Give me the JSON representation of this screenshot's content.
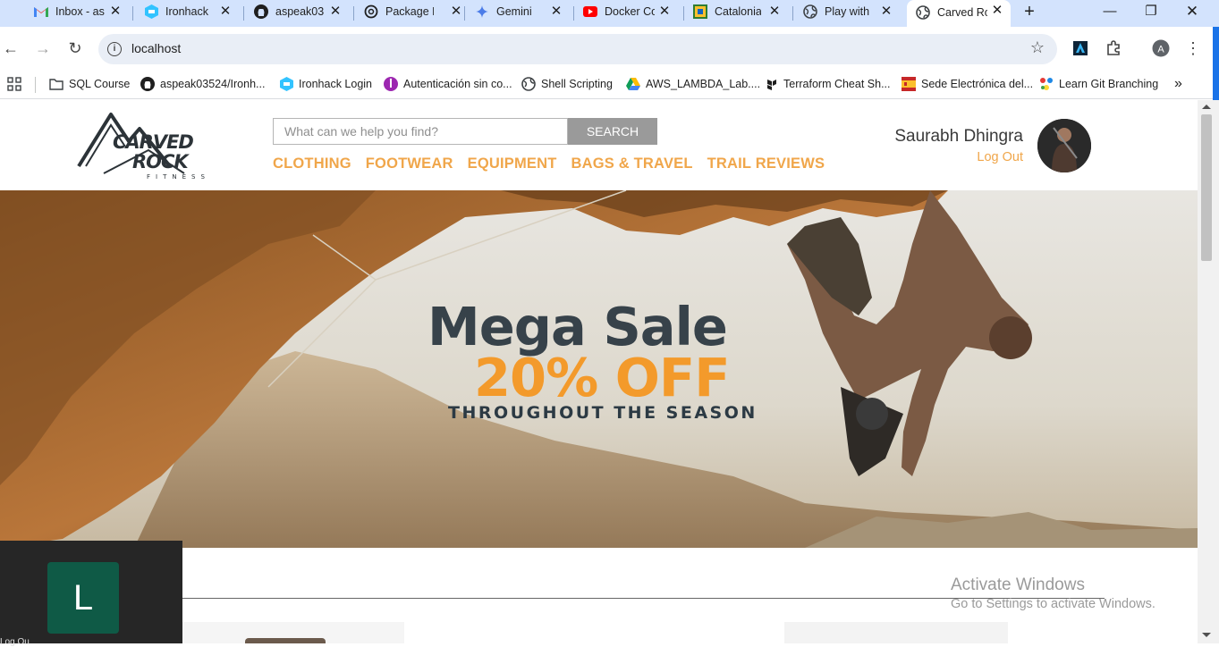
{
  "browser": {
    "tabs": [
      {
        "title": "Inbox - as",
        "icon": "gmail-icon"
      },
      {
        "title": "Ironhack",
        "icon": "ironhack-icon"
      },
      {
        "title": "aspeak03",
        "icon": "github-icon"
      },
      {
        "title": "Package M",
        "icon": "chatgpt-icon"
      },
      {
        "title": "Gemini",
        "icon": "gemini-icon"
      },
      {
        "title": "Docker Co",
        "icon": "youtube-icon"
      },
      {
        "title": "Catalonia",
        "icon": "catalonia-icon"
      },
      {
        "title": "Play with",
        "icon": "globe-icon"
      },
      {
        "title": "Carved Ro",
        "icon": "globe-icon",
        "active": true
      }
    ],
    "url": "localhost",
    "profile_initial": "A",
    "bookmarks": [
      {
        "label": "SQL Course",
        "icon": "folder-icon"
      },
      {
        "label": "aspeak03524/Ironh...",
        "icon": "github-icon"
      },
      {
        "label": "Ironhack Login",
        "icon": "ironhack-icon"
      },
      {
        "label": "Autenticación sin co...",
        "icon": "auth-icon"
      },
      {
        "label": "Shell Scripting",
        "icon": "globe-icon"
      },
      {
        "label": "AWS_LAMBDA_Lab....",
        "icon": "drive-icon"
      },
      {
        "label": "Terraform Cheat Sh...",
        "icon": "terraform-icon"
      },
      {
        "label": "Sede Electrónica del...",
        "icon": "spain-icon"
      },
      {
        "label": "Learn Git Branching",
        "icon": "git-icon"
      }
    ],
    "colors": {
      "tabstrip": "#d3e3fd",
      "omnibox": "#e9eef6"
    }
  },
  "site": {
    "logo_text_top": "CARVED",
    "logo_text_bottom": "ROCK",
    "logo_text_tag": "FITNESS",
    "search": {
      "placeholder": "What can we help you find?",
      "button": "SEARCH"
    },
    "nav": [
      "CLOTHING",
      "FOOTWEAR",
      "EQUIPMENT",
      "BAGS & TRAVEL",
      "TRAIL REVIEWS"
    ],
    "user": {
      "name": "Saurabh Dhingra",
      "logout": "Log Out"
    },
    "hero": {
      "title": "Mega Sale",
      "discount": "20% OFF",
      "subtitle": "THROUGHOUT THE SEASON"
    },
    "colors": {
      "accent": "#f0a64a",
      "hero_title": "#37424a",
      "discount": "#f39a2b"
    }
  },
  "overlay": {
    "watermark_title": "Activate Windows",
    "watermark_sub": "Go to Settings to activate Windows.",
    "popup_letter": "L",
    "popup_label": "Log Ou"
  }
}
